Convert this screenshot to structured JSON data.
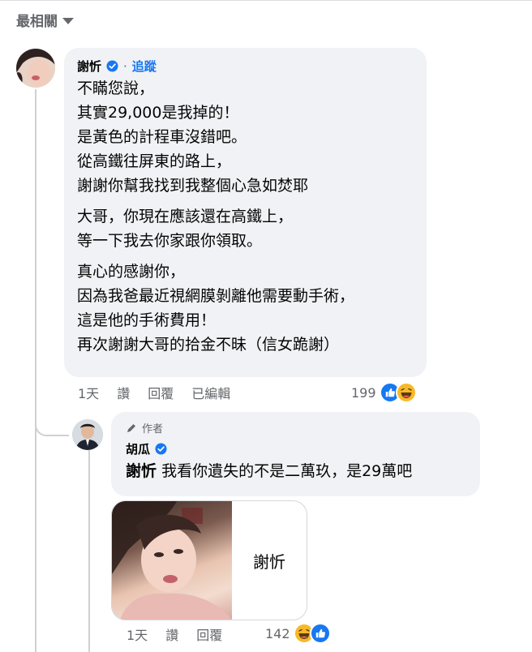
{
  "sort": {
    "label": "最相關"
  },
  "comment": {
    "author": "謝忻",
    "follow_label": "追蹤",
    "paragraphs": [
      [
        "不瞞您說，",
        "其實29,000是我掉的！",
        "是黃色的計程車沒錯吧。",
        "從高鐵往屏東的路上，",
        "謝謝你幫我找到我整個心急如焚耶"
      ],
      [
        "大哥，你現在應該還在高鐵上，",
        "等一下我去你家跟你領取。"
      ],
      [
        "真心的感謝你，",
        "因為我爸最近視網膜剝離他需要動手術，",
        "這是他的手術費用！",
        "再次謝謝大哥的拾金不昧（信女跪謝）"
      ]
    ],
    "actions": {
      "time": "1天",
      "like": "讚",
      "reply": "回覆",
      "edited": "已編輯"
    },
    "reaction_count": "199",
    "reactions": [
      "like-emoji",
      "haha-emoji"
    ]
  },
  "reply": {
    "role_label": "作者",
    "author": "胡瓜",
    "mention": "謝忻",
    "text": "我看你遺失的不是二萬玖，是29萬吧",
    "sticker_label": "謝忻",
    "actions": {
      "time": "1天",
      "like": "讚",
      "reply": "回覆"
    },
    "reaction_count": "142",
    "reactions": [
      "haha-emoji",
      "like-emoji"
    ]
  },
  "colors": {
    "link": "#1877f2",
    "muted": "#65676b",
    "bubble": "#f0f2f5"
  }
}
